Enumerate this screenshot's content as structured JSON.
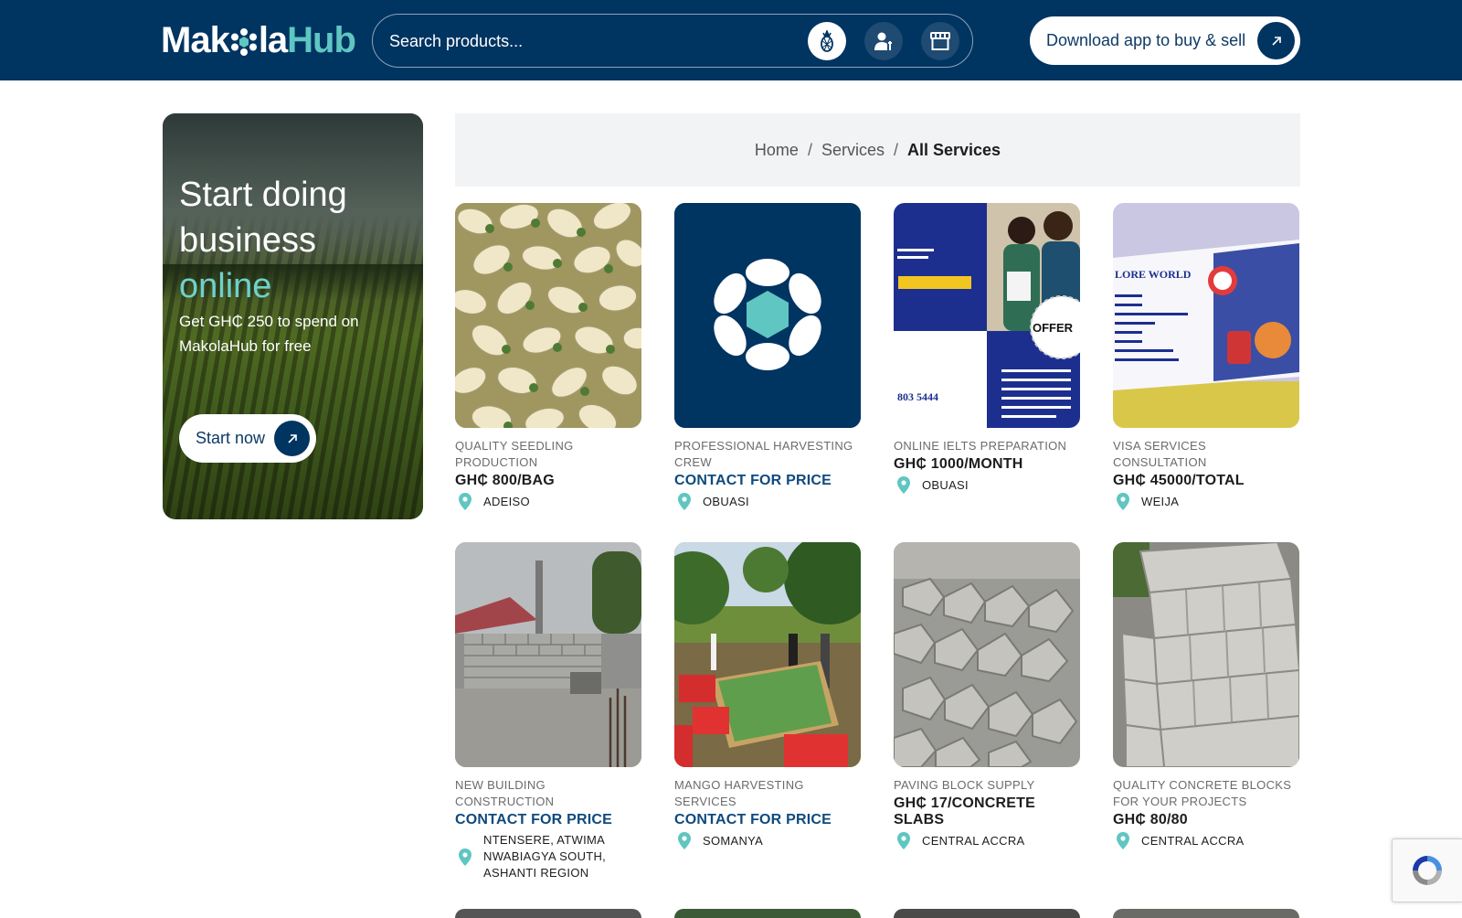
{
  "header": {
    "logo": {
      "part1": "Mak",
      "part2": "la",
      "part3": "Hub"
    },
    "search": {
      "placeholder": "Search products..."
    },
    "icons": [
      "pineapple-icon",
      "user-icon",
      "store-icon"
    ],
    "download_label": "Download app to buy & sell"
  },
  "promo": {
    "title_line": "Start doing business",
    "title_accent": "online",
    "subtitle": "Get GH₵ 250 to spend on MakolaHub for free",
    "cta": "Start now"
  },
  "breadcrumb": {
    "home": "Home",
    "services": "Services",
    "current": "All Services",
    "sep": "/"
  },
  "listings": [
    {
      "name": "QUALITY SEEDLING PRODUCTION",
      "price": "GH₵ 800/BAG",
      "contact": false,
      "location": "ADEISO"
    },
    {
      "name": "PROFESSIONAL HARVESTING CREW",
      "price": "CONTACT FOR PRICE",
      "contact": true,
      "location": "OBUASI"
    },
    {
      "name": "ONLINE IELTS PREPARATION",
      "price": "GH₵ 1000/MONTH",
      "contact": false,
      "location": "OBUASI"
    },
    {
      "name": "VISA SERVICES CONSULTATION",
      "price": "GH₵ 45000/TOTAL",
      "contact": false,
      "location": "WEIJA"
    },
    {
      "name": "NEW BUILDING CONSTRUCTION",
      "price": "CONTACT FOR PRICE",
      "contact": true,
      "location": "NTENSERE, ATWIMA NWABIAGYA SOUTH, ASHANTI REGION"
    },
    {
      "name": "MANGO HARVESTING SERVICES",
      "price": "CONTACT FOR PRICE",
      "contact": true,
      "location": "SOMANYA"
    },
    {
      "name": "PAVING BLOCK SUPPLY",
      "price": "GH₵ 17/CONCRETE SLABS",
      "contact": false,
      "location": "CENTRAL ACCRA"
    },
    {
      "name": "QUALITY CONCRETE BLOCKS FOR YOUR PROJECTS",
      "price": "GH₵ 80/80",
      "contact": false,
      "location": "CENTRAL ACCRA"
    }
  ],
  "image_art": {
    "ielts_tagline": "OFFER",
    "ielts_phone": "803 5444",
    "visa_sign": "LORE WORLD"
  },
  "colors": {
    "header_bg": "#003461",
    "accent_teal": "#5fc6c1",
    "contact_blue": "#0e4a7e",
    "crumb_bg": "#f2f3f4"
  }
}
